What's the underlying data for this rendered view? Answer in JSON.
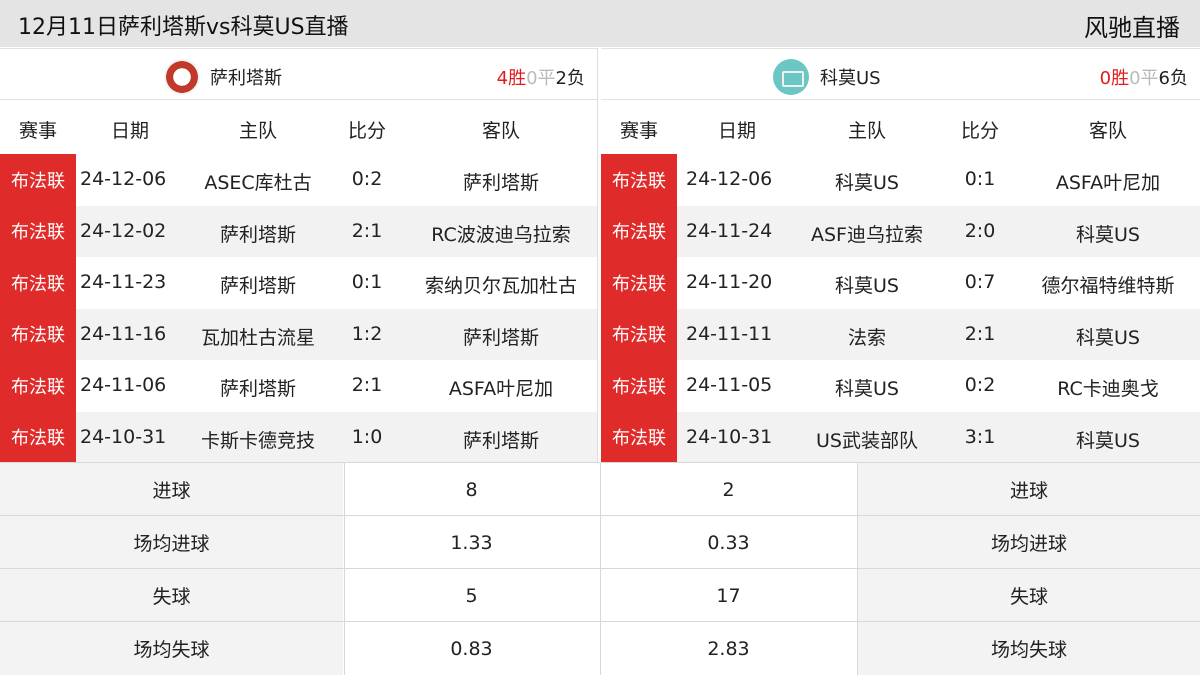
{
  "header": {
    "title": "12月11日萨利塔斯vs科莫US直播",
    "brand": "风驰直播"
  },
  "columns": {
    "league": "赛事",
    "date": "日期",
    "home": "主队",
    "score": "比分",
    "away": "客队"
  },
  "left": {
    "team": "萨利塔斯",
    "record": {
      "win": "4胜",
      "draw": "0平",
      "loss": "2负"
    },
    "matches": [
      {
        "league": "布法联",
        "date": "24-12-06",
        "home": "ASEC库杜古",
        "score": "0:2",
        "away": "萨利塔斯"
      },
      {
        "league": "布法联",
        "date": "24-12-02",
        "home": "萨利塔斯",
        "score": "2:1",
        "away": "RC波波迪乌拉索"
      },
      {
        "league": "布法联",
        "date": "24-11-23",
        "home": "萨利塔斯",
        "score": "0:1",
        "away": "索纳贝尔瓦加杜古"
      },
      {
        "league": "布法联",
        "date": "24-11-16",
        "home": "瓦加杜古流星",
        "score": "1:2",
        "away": "萨利塔斯"
      },
      {
        "league": "布法联",
        "date": "24-11-06",
        "home": "萨利塔斯",
        "score": "2:1",
        "away": "ASFA叶尼加"
      },
      {
        "league": "布法联",
        "date": "24-10-31",
        "home": "卡斯卡德竞技",
        "score": "1:0",
        "away": "萨利塔斯"
      }
    ]
  },
  "right": {
    "team": "科莫US",
    "record": {
      "win": "0胜",
      "draw": "0平",
      "loss": "6负"
    },
    "matches": [
      {
        "league": "布法联",
        "date": "24-12-06",
        "home": "科莫US",
        "score": "0:1",
        "away": "ASFA叶尼加"
      },
      {
        "league": "布法联",
        "date": "24-11-24",
        "home": "ASF迪乌拉索",
        "score": "2:0",
        "away": "科莫US"
      },
      {
        "league": "布法联",
        "date": "24-11-20",
        "home": "科莫US",
        "score": "0:7",
        "away": "德尔福特维特斯"
      },
      {
        "league": "布法联",
        "date": "24-11-11",
        "home": "法索",
        "score": "2:1",
        "away": "科莫US"
      },
      {
        "league": "布法联",
        "date": "24-11-05",
        "home": "科莫US",
        "score": "0:2",
        "away": "RC卡迪奥戈"
      },
      {
        "league": "布法联",
        "date": "24-10-31",
        "home": "US武装部队",
        "score": "3:1",
        "away": "科莫US"
      }
    ]
  },
  "stats": [
    {
      "label": "进球",
      "left": "8",
      "right": "2"
    },
    {
      "label": "场均进球",
      "left": "1.33",
      "right": "0.33"
    },
    {
      "label": "失球",
      "left": "5",
      "right": "17"
    },
    {
      "label": "场均失球",
      "left": "0.83",
      "right": "2.83"
    }
  ],
  "colors": {
    "league_badge": "#e02b2b",
    "win": "#e11c1c",
    "draw": "#bbbbbb",
    "header_bg": "#e4e4e4"
  }
}
